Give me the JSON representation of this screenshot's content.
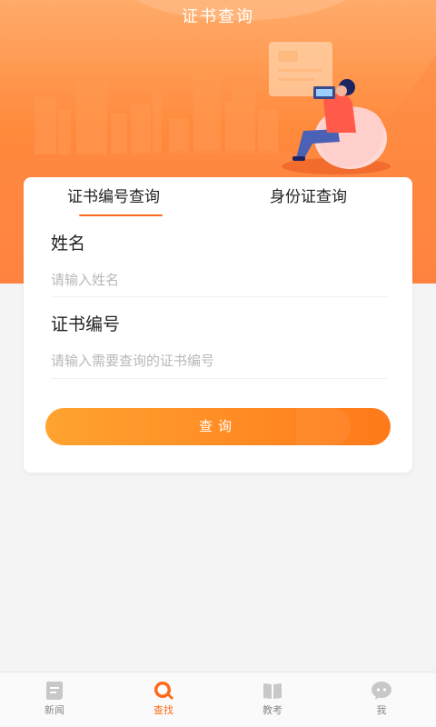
{
  "header": {
    "title": "证书查询"
  },
  "tabs": [
    {
      "label": "证书编号查询",
      "active": true
    },
    {
      "label": "身份证查询",
      "active": false
    }
  ],
  "form": {
    "name_label": "姓名",
    "name_placeholder": "请输入姓名",
    "name_value": "",
    "cert_label": "证书编号",
    "cert_placeholder": "请输入需要查询的证书编号",
    "cert_value": "",
    "submit_label": "查询"
  },
  "bottom_nav": [
    {
      "label": "新闻",
      "icon": "news-icon",
      "active": false
    },
    {
      "label": "查找",
      "icon": "search-icon",
      "active": true
    },
    {
      "label": "教考",
      "icon": "book-icon",
      "active": false
    },
    {
      "label": "我",
      "icon": "profile-chat-icon",
      "active": false
    }
  ],
  "colors": {
    "accent": "#ff6a1a",
    "header_top": "#ffab6a",
    "header_bottom": "#ff7a3a",
    "button_start": "#ffa330",
    "button_end": "#ff7a1a",
    "inactive_icon": "#c8c8c8"
  }
}
